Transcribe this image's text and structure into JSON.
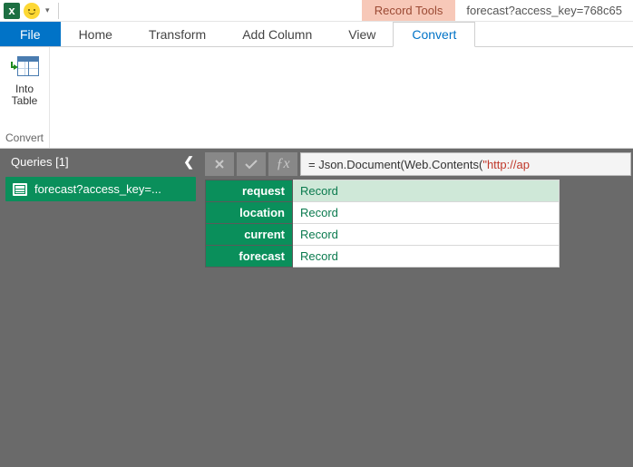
{
  "titlebar": {
    "context_tab": "Record Tools",
    "window_title": "forecast?access_key=768c65"
  },
  "tabs": {
    "file": "File",
    "home": "Home",
    "transform": "Transform",
    "add_column": "Add Column",
    "view": "View",
    "convert": "Convert"
  },
  "ribbon": {
    "into_table": {
      "line1": "Into",
      "line2": "Table"
    },
    "group_convert": "Convert"
  },
  "queries": {
    "header": "Queries [1]",
    "items": [
      {
        "label": "forecast?access_key=..."
      }
    ]
  },
  "formula": {
    "prefix": "= Json.Document(Web.Contents(",
    "string_start": "\"http://ap"
  },
  "record": {
    "rows": [
      {
        "key": "request",
        "value": "Record",
        "selected": true
      },
      {
        "key": "location",
        "value": "Record",
        "selected": false
      },
      {
        "key": "current",
        "value": "Record",
        "selected": false
      },
      {
        "key": "forecast",
        "value": "Record",
        "selected": false
      }
    ]
  }
}
